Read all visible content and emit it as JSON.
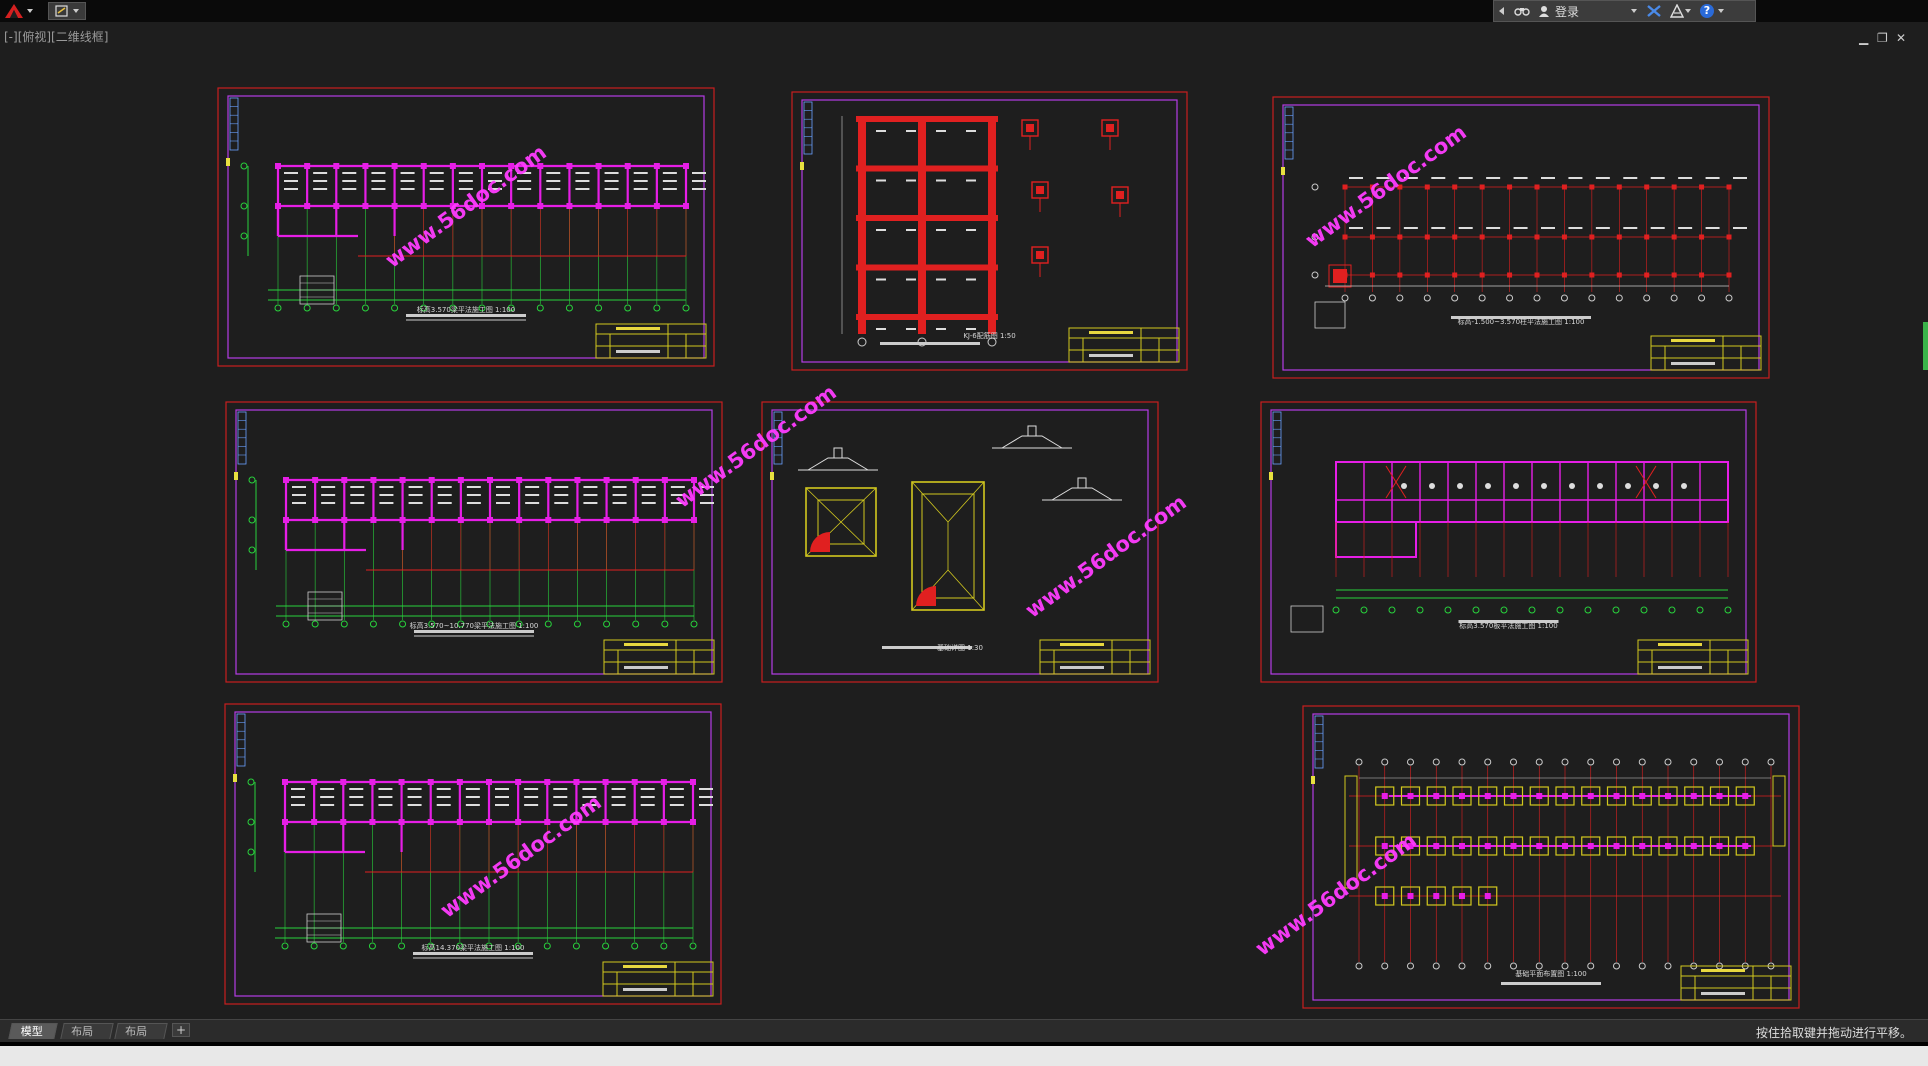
{
  "titlebar": {
    "login_label": "登录",
    "help_label": "?"
  },
  "viewport": {
    "label": "[-][俯视][二维线框]"
  },
  "drawing": {
    "watermark": "www.56doc.com",
    "sheet_titles": [
      "标高3.570梁平法施工图 1:100",
      "KJ-6配筋图 1:50",
      "标高-1.500~3.570柱平法施工图 1:100",
      "标高3.570~10.770梁平法施工图 1:100",
      "基础详图 1:30",
      "标高3.570板平法施工图 1:100",
      "标高14.370梁平法施工图 1:100",
      "基础平面布置图 1:100"
    ]
  },
  "layout_tabs": [
    {
      "label": "模型",
      "active": true
    },
    {
      "label": "布局1",
      "active": false
    },
    {
      "label": "布局2",
      "active": false
    }
  ],
  "add_tab_label": "+",
  "status": {
    "message": "按住拾取键并拖动进行平移。"
  },
  "colors": {
    "background": "#1e1e1e",
    "frame_red": "#c81e1e",
    "frame_magenta": "#b43ce6",
    "beam_magenta": "#e61ee6",
    "grid_green": "#28d23c",
    "column_red": "#e02020",
    "footing_yellow": "#d2c81e",
    "watermark": "#ff3cff"
  }
}
